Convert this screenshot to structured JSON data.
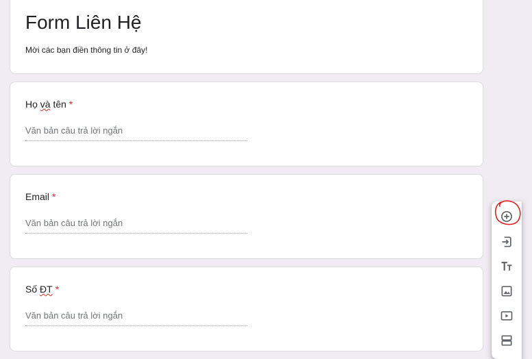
{
  "form": {
    "title": "Form Liên Hệ",
    "description": "Mời các bạn điền thông tin ở đây!"
  },
  "questions": [
    {
      "label_a": "Họ ",
      "label_b": "và",
      "label_c": " tên",
      "required": "*",
      "placeholder": "Văn bản câu trả lời ngắn"
    },
    {
      "label": "Email",
      "required": "*",
      "placeholder": "Văn bản câu trả lời ngắn"
    },
    {
      "label_a": "Số ",
      "label_b": "ĐT",
      "required": "*",
      "placeholder": "Văn bản câu trả lời ngắn"
    }
  ],
  "toolbar": {
    "icons": [
      "add-question-icon",
      "import-questions-icon",
      "add-title-icon",
      "add-image-icon",
      "add-video-icon",
      "add-section-icon"
    ],
    "icon_color": "#5f6368",
    "highlight_color": "#e0201d"
  }
}
